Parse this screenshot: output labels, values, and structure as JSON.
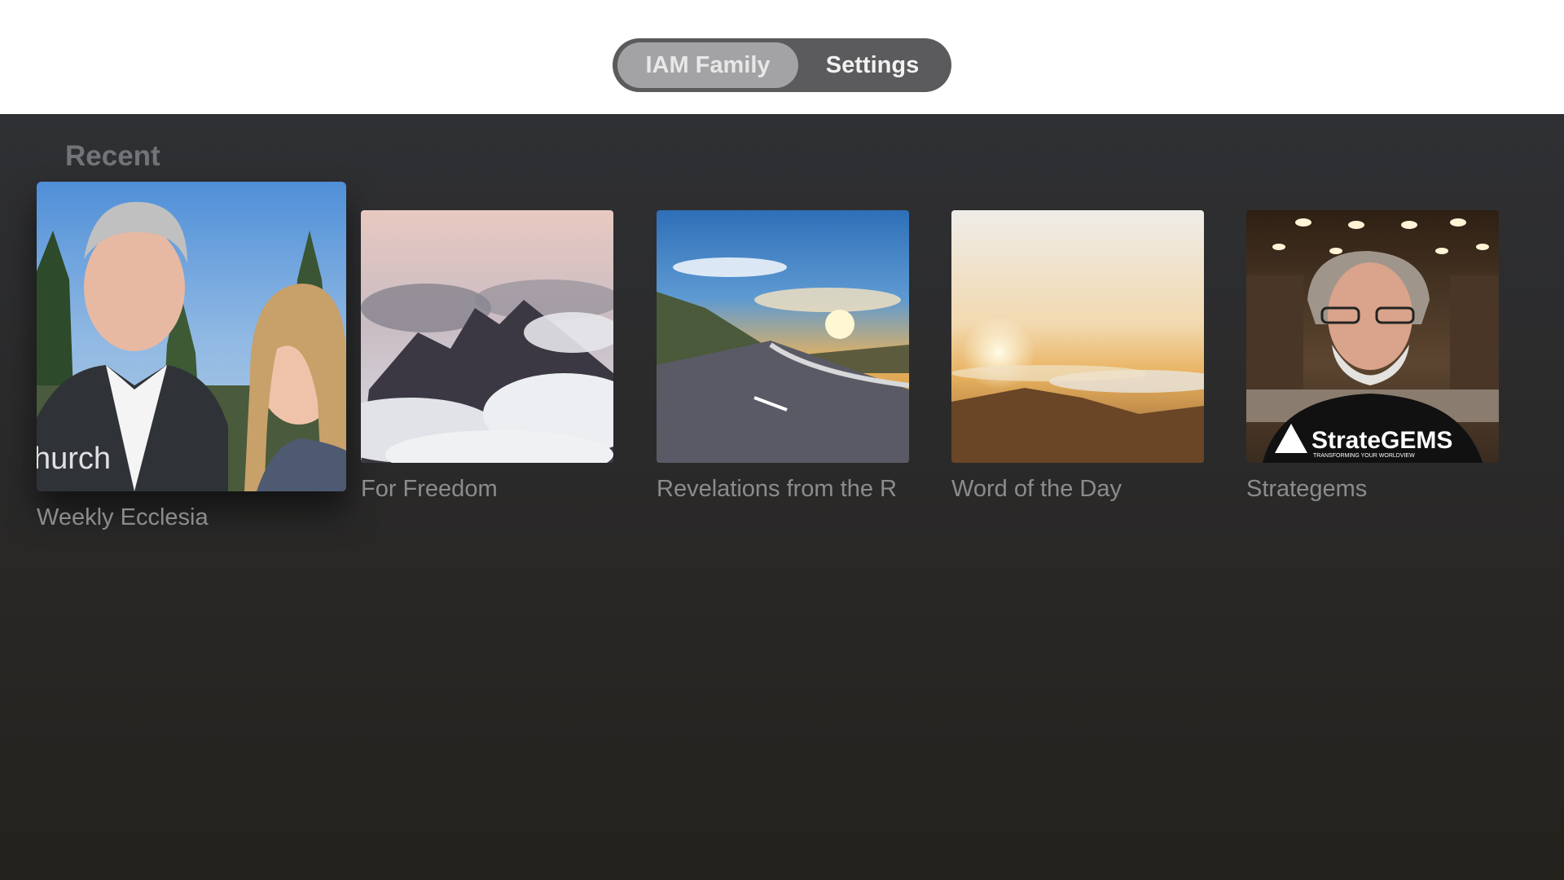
{
  "segmented": {
    "tabs": [
      {
        "label": "IAM Family",
        "selected": true
      },
      {
        "label": "Settings",
        "selected": false
      }
    ]
  },
  "recent": {
    "title": "Recent",
    "items": [
      {
        "title": "Weekly Ecclesia",
        "focused": true,
        "overlay_text": "hurch"
      },
      {
        "title": "For Freedom",
        "focused": false
      },
      {
        "title": "Revelations from the R",
        "focused": false
      },
      {
        "title": "Word of the Day",
        "focused": false
      },
      {
        "title": "Strategems",
        "focused": false,
        "logo_text": "StrateGEMS",
        "logo_tagline": "TRANSFORMING YOUR WORLDVIEW"
      }
    ]
  },
  "colors": {
    "segment_selected": "#a3a3a5",
    "segment_track": "#5b5b5d",
    "background_top": "#2f3033",
    "background_bottom": "#24221d"
  }
}
